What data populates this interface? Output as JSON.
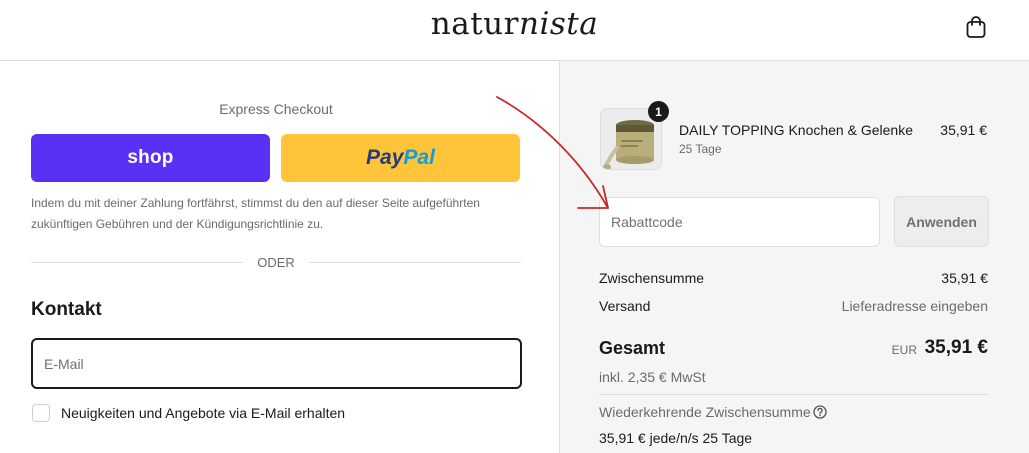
{
  "header": {
    "logo_part1": "natur",
    "logo_part2": "nista",
    "cart_icon": "shopping-bag-icon"
  },
  "express": {
    "title": "Express Checkout",
    "shop_label": "shop",
    "paypal_part1": "Pay",
    "paypal_part2": "Pal",
    "disclaimer": "Indem du mit deiner Zahlung fortfährst, stimmst du den auf dieser Seite aufgeführten zukünftigen Gebühren und der Kündigungsrichtlinie zu.",
    "shop_color": "#5a31f4",
    "paypal_color": "#ffc439"
  },
  "divider": {
    "label": "ODER"
  },
  "contact": {
    "heading": "Kontakt",
    "email_placeholder": "E-Mail",
    "newsletter_label": "Neuigkeiten und Angebote via E-Mail erhalten",
    "newsletter_checked": false
  },
  "cart": {
    "item": {
      "name": "DAILY TOPPING Knochen & Gelenke",
      "subtitle": "25 Tage",
      "price": "35,91 €",
      "quantity": "1"
    },
    "discount_placeholder": "Rabattcode",
    "apply_label": "Anwenden"
  },
  "summary": {
    "subtotal_label": "Zwischensumme",
    "subtotal_value": "35,91 €",
    "shipping_label": "Versand",
    "shipping_value": "Lieferadresse eingeben",
    "total_label": "Gesamt",
    "currency": "EUR",
    "total_value": "35,91 €",
    "tax_note": "inkl. 2,35 € MwSt",
    "recurring_label": "Wiederkehrende Zwischensumme",
    "recurring_value": "35,91 € jede/n/s 25 Tage"
  }
}
